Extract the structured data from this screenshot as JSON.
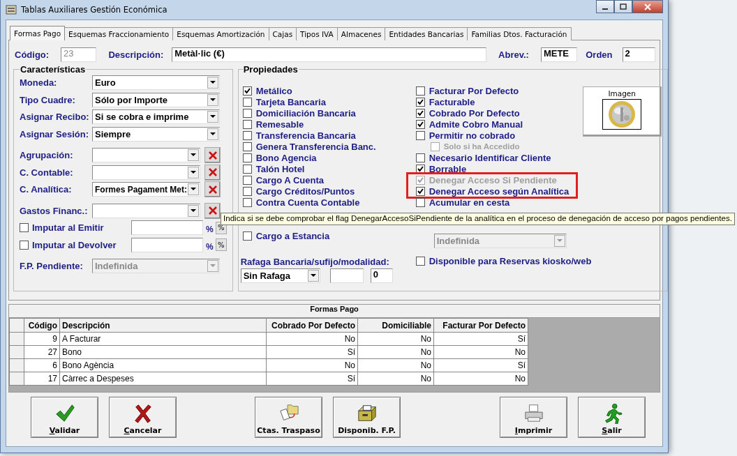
{
  "window": {
    "title": "Tablas Auxiliares Gestión Económica"
  },
  "tabs": [
    {
      "label": "Formas Pago",
      "selected": true
    },
    {
      "label": "Esquemas Fraccionamiento",
      "selected": false
    },
    {
      "label": "Esquemas Amortización",
      "selected": false
    },
    {
      "label": "Cajas",
      "selected": false
    },
    {
      "label": "Tipos IVA",
      "selected": false
    },
    {
      "label": "Almacenes",
      "selected": false
    },
    {
      "label": "Entidades Bancarias",
      "selected": false
    },
    {
      "label": "Familias Dtos. Facturación",
      "selected": false
    }
  ],
  "header": [
    {
      "label": "Código:",
      "value": "23",
      "kind": "readonly"
    },
    {
      "label": "Descripción:",
      "value": "Metàl·lic (€)",
      "kind": "wide"
    },
    {
      "label": "Abrev.:",
      "value": "METE",
      "kind": "short"
    },
    {
      "label": "Orden",
      "value": "2",
      "kind": "short"
    }
  ],
  "caracteristicas": {
    "title": "Características",
    "groups": [
      [
        {
          "kind": "select",
          "label": "Moneda:",
          "value": "Euro"
        },
        {
          "kind": "select",
          "label": "Tipo Cuadre:",
          "value": "Sólo por Importe"
        },
        {
          "kind": "select",
          "label": "Asignar Recibo:",
          "value": "Si se cobra e imprime"
        },
        {
          "kind": "select",
          "label": "Asignar Sesión:",
          "value": "Siempre"
        }
      ],
      [
        {
          "kind": "select_clear",
          "label": "Agrupación:"
        },
        {
          "kind": "select_clear",
          "label": "C. Contable:"
        },
        {
          "kind": "select_clear",
          "label": "C. Analítica:",
          "value": "Formes Pagament Met:"
        }
      ],
      [
        {
          "kind": "select_clear",
          "label": "Gastos Financ.:"
        },
        {
          "kind": "check_pct",
          "label": "Imputar al Emitir",
          "checked": false,
          "unit": "%",
          "button": "%"
        },
        {
          "kind": "check_pct",
          "label": "Imputar al Devolver",
          "checked": false,
          "unit": "%",
          "button": "%"
        }
      ],
      [
        {
          "kind": "select_disabled",
          "label": "F.P. Pendiente:",
          "value": "Indefinida"
        }
      ]
    ]
  },
  "propiedades": {
    "title": "Propiedades",
    "left": [
      {
        "label": "Metálico",
        "checked": true
      },
      {
        "label": "Tarjeta Bancaria",
        "checked": false
      },
      {
        "label": "Domiciliación Bancaria",
        "checked": false
      },
      {
        "label": "Remesable",
        "checked": false
      },
      {
        "label": "Transferencia Bancaria",
        "checked": false
      },
      {
        "label": "Genera Transferencia Banc.",
        "checked": false
      },
      {
        "label": "Bono Agencia",
        "checked": false
      },
      {
        "label": "Talón Hotel",
        "checked": false
      },
      {
        "label": "Cargo A Cuenta",
        "checked": false
      },
      {
        "label": "Cargo Créditos/Puntos",
        "checked": false
      },
      {
        "label": "Contra Cuenta Contable",
        "checked": false
      },
      {
        "label": "Cargo a Estancia",
        "checked": false
      }
    ],
    "right": [
      {
        "kind": "checkbox",
        "label": "Facturar Por Defecto",
        "checked": false,
        "disabled": false
      },
      {
        "kind": "checkbox",
        "label": "Facturable",
        "checked": true,
        "disabled": false
      },
      {
        "kind": "checkbox",
        "label": "Cobrado Por Defecto",
        "checked": true,
        "disabled": false
      },
      {
        "kind": "checkbox",
        "label": "Admite Cobro Manual",
        "checked": true,
        "disabled": false
      },
      {
        "kind": "checkbox",
        "label": "Permitir no cobrado",
        "checked": false,
        "disabled": false,
        "children": [
          {
            "kind": "checkbox",
            "label": "Solo si ha Accedido",
            "checked": false,
            "disabled": true
          }
        ]
      },
      {
        "kind": "checkbox",
        "label": "Necesario Identificar Cliente",
        "checked": false,
        "disabled": false
      },
      {
        "kind": "checkbox",
        "label": "Borrable",
        "checked": true,
        "disabled": false
      },
      {
        "kind": "highlight",
        "children": [
          {
            "kind": "checkbox",
            "label": "Denegar Acceso Si Pendiente",
            "checked": true,
            "disabled": true
          },
          {
            "kind": "checkbox",
            "label": "Denegar Acceso según Analítica",
            "checked": true,
            "disabled": false
          }
        ]
      },
      {
        "kind": "checkbox",
        "label": "Acumular en cesta",
        "checked": false,
        "disabled": false
      },
      {
        "kind": "select",
        "value": "Indefinida",
        "disabled": true
      },
      {
        "kind": "checkbox",
        "label": "Disponible para Reservas kiosko/web",
        "checked": false,
        "disabled": false
      }
    ],
    "rafaga": {
      "label": "Rafaga Bancaria/sufijo/modalidad:",
      "select": "Sin Rafaga",
      "modalidad": "0"
    },
    "imagen": {
      "label": "Imagen"
    }
  },
  "tooltip": {
    "text": "Indica si se debe comprobar el flag DenegarAccesoSiPendiente de la analítica en el proceso de denegación de acceso por pagos pendientes."
  },
  "grid": {
    "title": "Formas Pago",
    "columns": [
      {
        "label": "Código"
      },
      {
        "label": "Descripción"
      },
      {
        "label": "Cobrado Por Defecto"
      },
      {
        "label": "Domiciliable"
      },
      {
        "label": "Facturar Por Defecto"
      }
    ],
    "rows": [
      [
        "9",
        "A Facturar",
        "No",
        "No",
        "Sí"
      ],
      [
        "27",
        "Bono",
        "Sí",
        "No",
        "No"
      ],
      [
        "6",
        "Bono Agència",
        "No",
        "No",
        "Sí"
      ],
      [
        "17",
        "Càrrec a Despeses",
        "Sí",
        "No",
        "No"
      ]
    ]
  },
  "buttons": [
    [
      {
        "label": "Validar",
        "kind": "validate",
        "mnemonic": true
      },
      {
        "label": "Cancelar",
        "kind": "cancel",
        "mnemonic": true
      }
    ],
    [
      {
        "label": "Ctas. Traspaso",
        "kind": "transfer",
        "mnemonic": false
      },
      {
        "label": "Disponib. F.P.",
        "kind": "drawer",
        "mnemonic": false
      }
    ],
    [
      {
        "label": "Imprimir",
        "kind": "print",
        "mnemonic": true
      },
      {
        "label": "Salir",
        "kind": "exit",
        "mnemonic": true
      }
    ]
  ]
}
